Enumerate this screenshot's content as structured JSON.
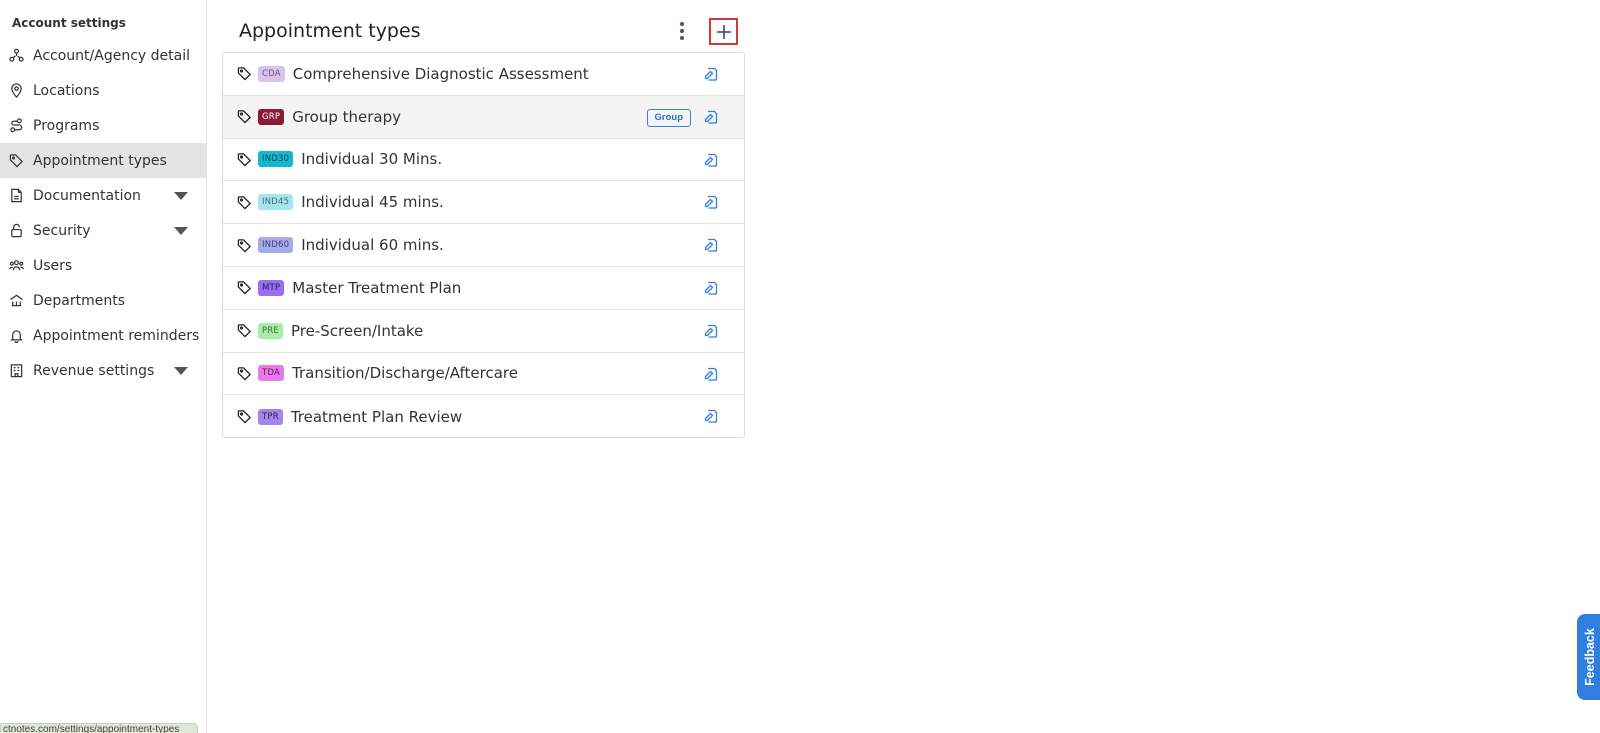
{
  "sidebar": {
    "heading": "Account settings",
    "items": [
      {
        "label": "Account/Agency detail",
        "icon": "organization-icon"
      },
      {
        "label": "Locations",
        "icon": "location-pin-icon"
      },
      {
        "label": "Programs",
        "icon": "route-icon"
      },
      {
        "label": "Appointment types",
        "icon": "tag-icon",
        "active": true
      },
      {
        "label": "Documentation",
        "icon": "document-icon",
        "expandable": true
      },
      {
        "label": "Security",
        "icon": "lock-icon",
        "expandable": true
      },
      {
        "label": "Users",
        "icon": "users-icon"
      },
      {
        "label": "Departments",
        "icon": "departments-icon"
      },
      {
        "label": "Appointment reminders",
        "icon": "bell-icon"
      },
      {
        "label": "Revenue settings",
        "icon": "building-icon",
        "expandable": true
      }
    ]
  },
  "status_url": "ctnotes.com/settings/appointment-types",
  "panel": {
    "title": "Appointment types",
    "rows": [
      {
        "code": "CDA",
        "name": "Comprehensive Diagnostic Assessment",
        "code_bg": "#d7c4ee",
        "code_fg": "#6a5a80"
      },
      {
        "code": "GRP",
        "name": "Group therapy",
        "code_bg": "#8b1a35",
        "code_fg": "#ffffff",
        "badge": "Group"
      },
      {
        "code": "IND30",
        "name": "Individual 30 Mins.",
        "code_bg": "#14b8cc",
        "code_fg": "#0b4b55"
      },
      {
        "code": "IND45",
        "name": "Individual 45 mins.",
        "code_bg": "#a6e6ee",
        "code_fg": "#3c6f76"
      },
      {
        "code": "IND60",
        "name": "Individual 60 mins.",
        "code_bg": "#a5abe6",
        "code_fg": "#3d4280"
      },
      {
        "code": "MTP",
        "name": "Master Treatment Plan",
        "code_bg": "#9a6ef0",
        "code_fg": "#2c1a55"
      },
      {
        "code": "PRE",
        "name": "Pre-Screen/Intake",
        "code_bg": "#a8ecaa",
        "code_fg": "#3c6f3e"
      },
      {
        "code": "TDA",
        "name": "Transition/Discharge/Aftercare",
        "code_bg": "#e879ec",
        "code_fg": "#5a1f5d"
      },
      {
        "code": "TPR",
        "name": "Treatment Plan Review",
        "code_bg": "#a386e8",
        "code_fg": "#33205e"
      }
    ]
  },
  "feedback_label": "Feedback",
  "colors": {
    "accent": "#2f7ee0",
    "active_bg": "#e4e4e4",
    "highlight_border": "#d33a3a",
    "edit_icon": "#2f7ee0"
  }
}
